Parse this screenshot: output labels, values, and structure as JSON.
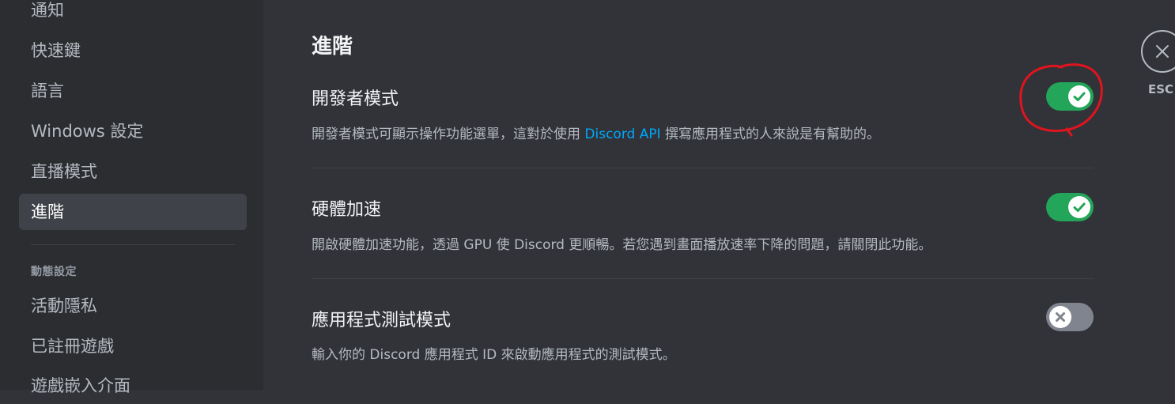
{
  "sidebar": {
    "items": [
      {
        "label": "通知"
      },
      {
        "label": "快速鍵"
      },
      {
        "label": "語言"
      },
      {
        "label": "Windows 設定"
      },
      {
        "label": "直播模式"
      },
      {
        "label": "進階"
      }
    ],
    "section_header": "動態設定",
    "section_items": [
      {
        "label": "活動隱私"
      },
      {
        "label": "已註冊遊戲"
      },
      {
        "label": "遊戲嵌入介面"
      }
    ],
    "active_item": "進階"
  },
  "main": {
    "title": "進階",
    "settings": [
      {
        "title": "開發者模式",
        "desc_before": "開發者模式可顯示操作功能選單，這對於使用 ",
        "desc_link": "Discord API",
        "desc_after": " 撰寫應用程式的人來說是有幫助的。",
        "enabled": true
      },
      {
        "title": "硬體加速",
        "desc": "開啟硬體加速功能，透過 GPU 使 Discord 更順暢。若您遇到畫面播放速率下降的問題，請關閉此功能。",
        "enabled": true
      },
      {
        "title": "應用程式測試模式",
        "desc": "輸入你的 Discord 應用程式 ID 來啟動應用程式的測試模式。",
        "enabled": false
      }
    ]
  },
  "close": {
    "label": "ESC",
    "icon": "close-icon"
  },
  "colors": {
    "background": "#313338",
    "sidebar": "#2b2d31",
    "toggle_on": "#23a55a",
    "toggle_off": "#80848e",
    "link": "#00a8fc",
    "annotation": "#e0141e"
  }
}
